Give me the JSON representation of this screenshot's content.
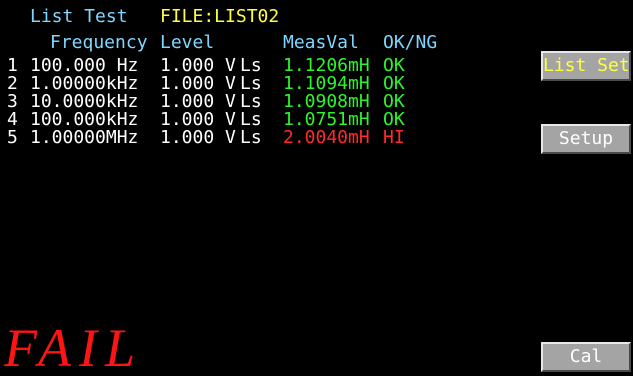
{
  "header": {
    "mode": "List Test",
    "file": "FILE:LIST02"
  },
  "table": {
    "columns": {
      "frequency": "Frequency",
      "level": "Level",
      "measval": "MeasVal",
      "result": "OK/NG"
    },
    "rows": [
      {
        "index": "1",
        "frequency": "100.000 Hz",
        "level": "1.000 V",
        "param": "Ls",
        "measval": "1.1206mH",
        "result": "OK",
        "status_color": "#2cf52c"
      },
      {
        "index": "2",
        "frequency": "1.00000kHz",
        "level": "1.000 V",
        "param": "Ls",
        "measval": "1.1094mH",
        "result": "OK",
        "status_color": "#2cf52c"
      },
      {
        "index": "3",
        "frequency": "10.0000kHz",
        "level": "1.000 V",
        "param": "Ls",
        "measval": "1.0908mH",
        "result": "OK",
        "status_color": "#2cf52c"
      },
      {
        "index": "4",
        "frequency": "100.000kHz",
        "level": "1.000 V",
        "param": "Ls",
        "measval": "1.0751mH",
        "result": "OK",
        "status_color": "#2cf52c"
      },
      {
        "index": "5",
        "frequency": "1.00000MHz",
        "level": "1.000 V",
        "param": "Ls",
        "measval": "2.0040mH",
        "result": "HI",
        "status_color": "#ff2a2a"
      }
    ]
  },
  "softkeys": {
    "list_set": "List Set",
    "setup": "Setup",
    "cal": "Cal"
  },
  "verdict": "FAIL",
  "colors": {
    "label": "#7fd6ff",
    "file": "#ffff40",
    "ok": "#2cf52c",
    "fail": "#ff2a2a",
    "key_face": "#a4a4a4"
  }
}
